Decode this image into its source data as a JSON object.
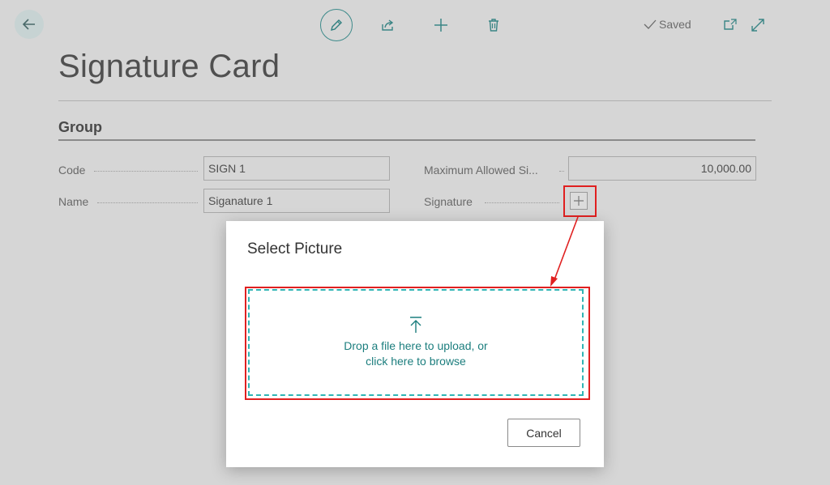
{
  "toolbar": {
    "back_icon": "arrow-left-icon",
    "edit_icon": "pencil-icon",
    "share_icon": "share-icon",
    "new_icon": "plus-icon",
    "delete_icon": "trash-icon",
    "saved_label": "Saved",
    "open_new_window_icon": "open-in-new-window-icon",
    "expand_icon": "expand-icon"
  },
  "page": {
    "title": "Signature Card"
  },
  "group": {
    "title": "Group",
    "fields": {
      "code_label": "Code",
      "code_value": "SIGN 1",
      "name_label": "Name",
      "name_value": "Siganature 1",
      "max_label": "Maximum Allowed Si...",
      "max_value": "10,000.00",
      "signature_label": "Signature"
    }
  },
  "dialog": {
    "title": "Select Picture",
    "drop_line1": "Drop a file here to upload, or",
    "drop_line2": "click here to browse",
    "cancel_label": "Cancel"
  },
  "colors": {
    "accent": "#1c7e7e",
    "highlight": "#e02020",
    "background": "#d6d6d6"
  }
}
